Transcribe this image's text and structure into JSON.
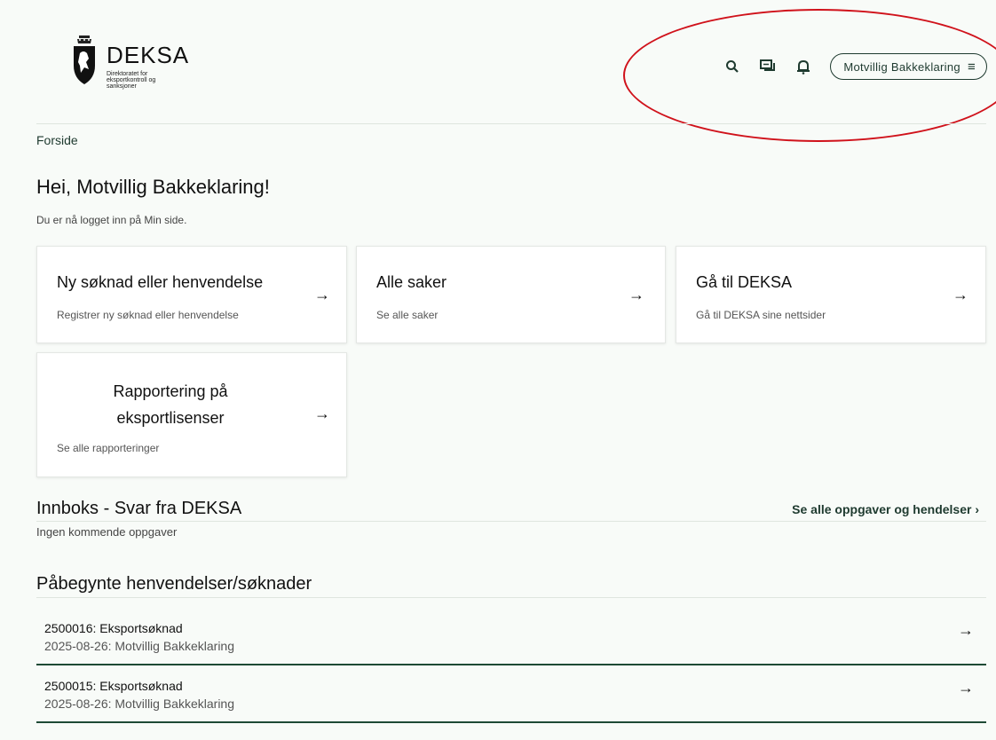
{
  "header": {
    "logo_name": "DEKSA",
    "logo_subtitle": "Direktoratet for eksportkontroll og sanksjoner",
    "user_button_label": "Motvillig Bakkeklaring",
    "icons": [
      "search-icon",
      "chat-icon",
      "bell-icon",
      "menu-icon"
    ]
  },
  "breadcrumb": "Forside",
  "greeting": "Hei, Motvillig Bakkeklaring!",
  "logged_in_text": "Du er nå logget inn på Min side.",
  "cards": [
    {
      "title": "Ny søknad eller henvendelse",
      "description": "Registrer ny søknad eller henvendelse"
    },
    {
      "title": "Alle saker",
      "description": "Se alle saker"
    },
    {
      "title": "Gå til DEKSA",
      "description": "Gå til DEKSA sine nettsider"
    },
    {
      "title_line1": "Rapportering på",
      "title_line2": "eksportlisenser",
      "description": "Se alle rapporteringer"
    }
  ],
  "arrow_glyph": "→",
  "inbox": {
    "title": "Innboks - Svar fra DEKSA",
    "see_all_label": "Se alle oppgaver og hendelser ›",
    "empty_text": "Ingen kommende oppgaver"
  },
  "started": {
    "title": "Påbegynte henvendelser/søknader",
    "items": [
      {
        "title": "2500016: Eksportsøknad",
        "subtitle": "2025-08-26: Motvillig Bakkeklaring"
      },
      {
        "title": "2500015: Eksportsøknad",
        "subtitle": "2025-08-26: Motvillig Bakkeklaring"
      }
    ]
  },
  "colors": {
    "brand": "#1e3a2f",
    "annotation": "#d0121b",
    "background": "#f8fbf8"
  }
}
